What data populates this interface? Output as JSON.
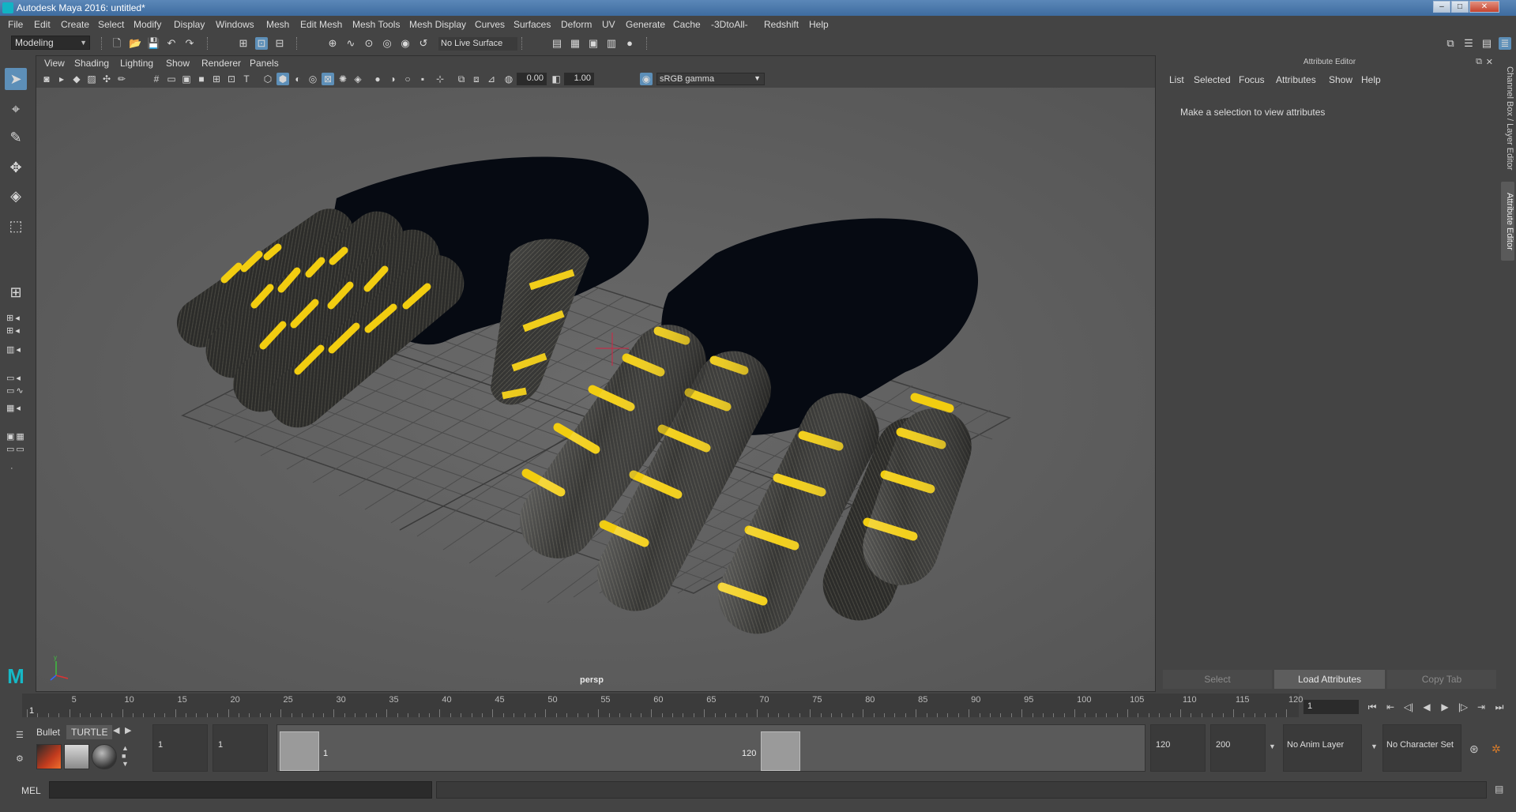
{
  "window": {
    "title": "Autodesk Maya 2016: untitled*",
    "minimize": "–",
    "maximize": "□",
    "close": "✕"
  },
  "menus": [
    "File",
    "Edit",
    "Create",
    "Select",
    "Modify",
    "Display",
    "Windows",
    "Mesh",
    "Edit Mesh",
    "Mesh Tools",
    "Mesh Display",
    "Curves",
    "Surfaces",
    "Deform",
    "UV",
    "Generate",
    "Cache",
    "-3DtoAll-",
    "Redshift",
    "Help"
  ],
  "statusline": {
    "mode": "Modeling",
    "live_surface": "No Live Surface"
  },
  "viewport": {
    "menus": [
      "View",
      "Shading",
      "Lighting",
      "Show",
      "Renderer",
      "Panels"
    ],
    "exposure": "0.00",
    "gamma": "1.00",
    "color_management": "sRGB gamma",
    "camera": "persp"
  },
  "attribute_editor": {
    "title": "Attribute Editor",
    "menus": [
      "List",
      "Selected",
      "Focus",
      "Attributes",
      "Show",
      "Help"
    ],
    "message": "Make a selection to view attributes",
    "buttons": [
      "Select",
      "Load Attributes",
      "Copy Tab"
    ],
    "side_tabs": [
      "Channel Box / Layer Editor",
      "Attribute Editor"
    ]
  },
  "timeline": {
    "ticks": [
      "1",
      "5",
      "10",
      "15",
      "20",
      "25",
      "30",
      "35",
      "40",
      "45",
      "50",
      "55",
      "60",
      "65",
      "70",
      "75",
      "80",
      "85",
      "90",
      "95",
      "100",
      "105",
      "110",
      "115",
      "120"
    ],
    "current_frame": "1"
  },
  "range": {
    "start": "1",
    "playback_start": "1",
    "range_start_label": "1",
    "range_end_label": "120",
    "playback_end": "120",
    "end": "200",
    "anim_layer": "No Anim Layer",
    "character_set": "No Character Set"
  },
  "shelf": {
    "tabs": [
      "Bullet",
      "TURTLE"
    ]
  },
  "commandline": {
    "label": "MEL"
  },
  "colors": {
    "accent": "#5d8fb8",
    "maya_teal": "#16b8c6",
    "stripe": "#f2cd10"
  }
}
